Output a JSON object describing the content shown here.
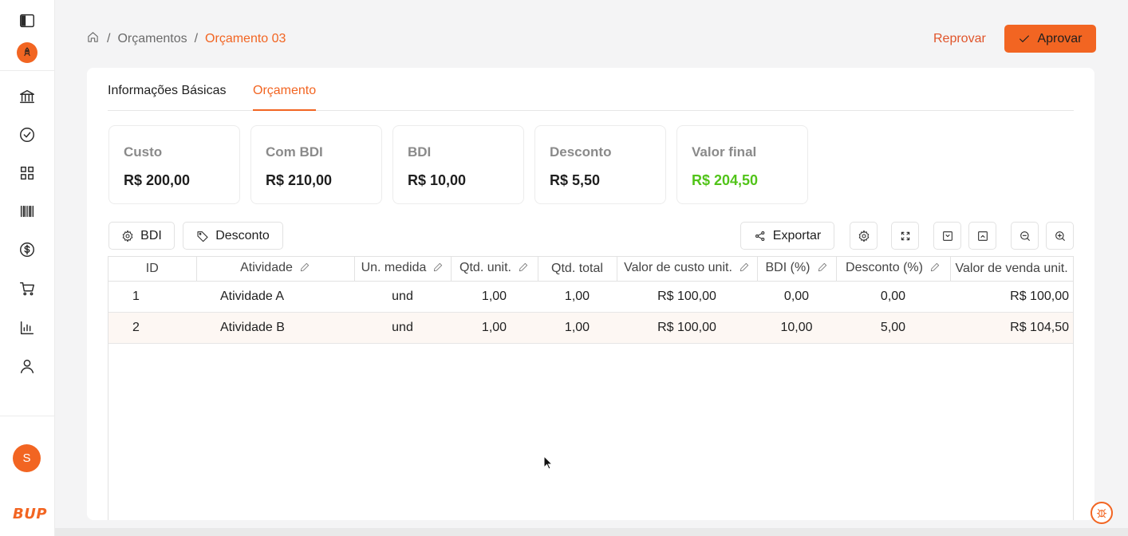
{
  "sidebar": {
    "icons": [
      "panel-toggle-icon",
      "bank-icon",
      "check-circle-icon",
      "grid-icon",
      "barcode-icon",
      "dollar-icon",
      "cart-icon",
      "bar-chart-icon",
      "user-icon"
    ],
    "avatar_initial": "S",
    "logo_text": "BUP"
  },
  "breadcrumb": {
    "items": [
      "Orçamentos"
    ],
    "current": "Orçamento 03"
  },
  "actions": {
    "reject_label": "Reprovar",
    "approve_label": "Aprovar"
  },
  "tabs": [
    {
      "label": "Informações Básicas",
      "active": false
    },
    {
      "label": "Orçamento",
      "active": true
    }
  ],
  "stats": [
    {
      "label": "Custo",
      "value": "R$ 200,00"
    },
    {
      "label": "Com BDI",
      "value": "R$ 210,00"
    },
    {
      "label": "BDI",
      "value": "R$ 10,00"
    },
    {
      "label": "Desconto",
      "value": "R$ 5,50"
    },
    {
      "label": "Valor final",
      "value": "R$ 204,50",
      "color": "#52c41a"
    }
  ],
  "toolbar": {
    "bdi_label": "BDI",
    "desconto_label": "Desconto",
    "export_label": "Exportar"
  },
  "table": {
    "columns": [
      "ID",
      "Atividade",
      "Un. medida",
      "Qtd. unit.",
      "Qtd. total",
      "Valor de custo unit.",
      "BDI (%)",
      "Desconto (%)",
      "Valor de venda unit."
    ],
    "rows": [
      [
        "1",
        "Atividade A",
        "und",
        "1,00",
        "1,00",
        "R$ 100,00",
        "0,00",
        "0,00",
        "R$ 100,00"
      ],
      [
        "2",
        "Atividade B",
        "und",
        "1,00",
        "1,00",
        "R$ 100,00",
        "10,00",
        "5,00",
        "R$ 104,50"
      ]
    ]
  },
  "colors": {
    "accent": "#f26522",
    "success": "#52c41a"
  }
}
